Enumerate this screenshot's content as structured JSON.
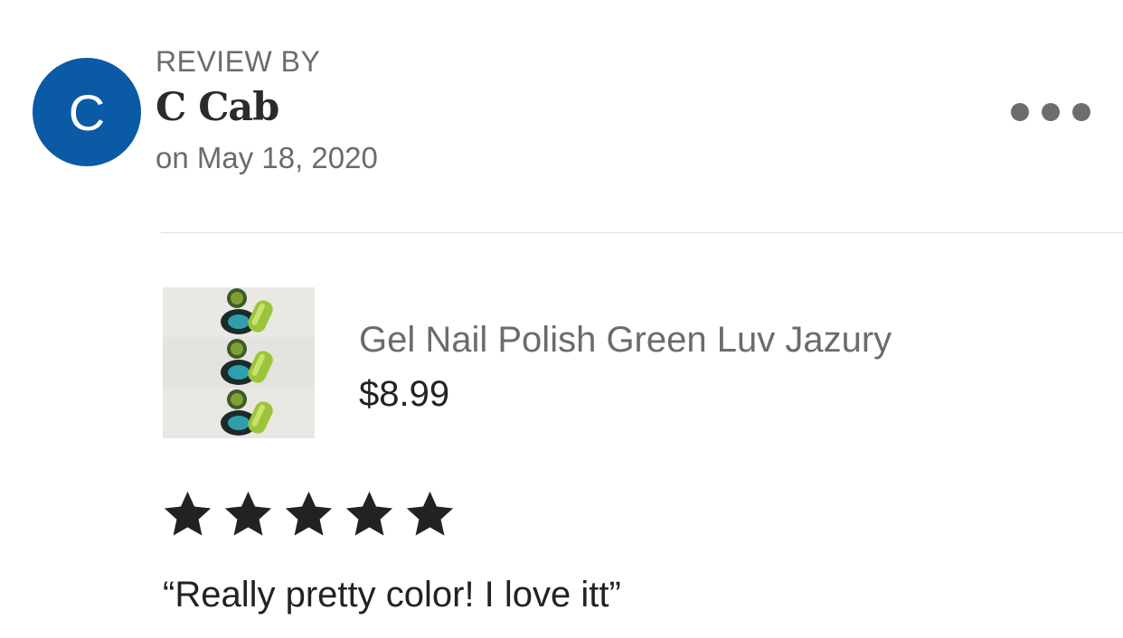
{
  "reviewer": {
    "avatar_initial": "C",
    "avatar_color": "#0b5aa5",
    "label": "REVIEW BY",
    "name": "C Cab",
    "date": "on May 18, 2020"
  },
  "menu": {
    "icon": "more-horizontal-icon"
  },
  "product": {
    "title": "Gel Nail Polish Green Luv Jazury",
    "price": "$8.99",
    "image_icon": "nail-polish-bottles-image"
  },
  "rating": {
    "value": 5,
    "max": 5,
    "star_color": "#222222"
  },
  "review": {
    "text": "“Really pretty color! I love itt”"
  }
}
